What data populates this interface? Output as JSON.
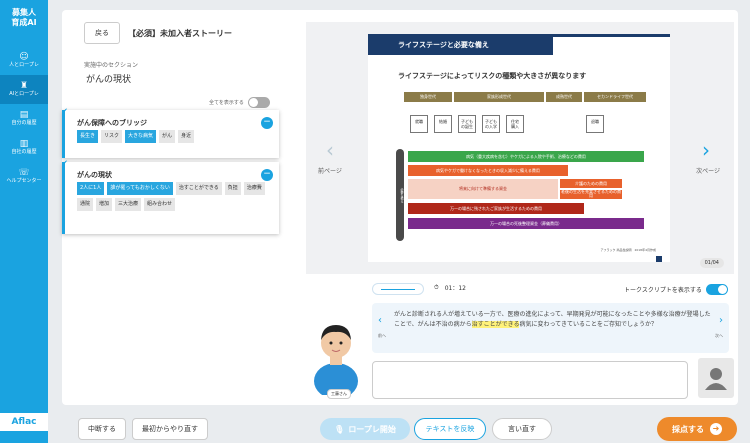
{
  "sidebar": {
    "brand_line1": "募集人",
    "brand_line2": "育成AI",
    "items": [
      {
        "label": "人とロープレ",
        "icon": "smile-icon",
        "glyph": "☺"
      },
      {
        "label": "AIとロープレ",
        "icon": "robot-icon",
        "glyph": "♜"
      },
      {
        "label": "自分の履歴",
        "icon": "history-icon",
        "glyph": "▤"
      },
      {
        "label": "自社の履歴",
        "icon": "bar-chart-icon",
        "glyph": "▥"
      },
      {
        "label": "ヘルプセンター",
        "icon": "headset-icon",
        "glyph": "☏"
      }
    ],
    "logo": "Aflac"
  },
  "header": {
    "back_label": "戻る",
    "title": "【必須】未加入者ストーリー"
  },
  "section": {
    "label": "実施中のセクション",
    "value": "がんの現状",
    "show_all_label": "全てを表示する"
  },
  "keywords": [
    {
      "title": "がん保障へのブリッジ",
      "tags": [
        {
          "text": "長生き",
          "hl": true
        },
        {
          "text": "リスク",
          "hl": false
        },
        {
          "text": "大きな病気",
          "hl": true
        },
        {
          "text": "がん",
          "hl": false
        },
        {
          "text": "身近",
          "hl": false
        }
      ]
    },
    {
      "title": "がんの現状",
      "tags": [
        {
          "text": "2人に1人",
          "hl": true
        },
        {
          "text": "誰が罹ってもおかしくない",
          "hl": true
        },
        {
          "text": "治すことができる",
          "hl": false
        },
        {
          "text": "負担",
          "hl": false
        },
        {
          "text": "治療費",
          "hl": false
        },
        {
          "text": "通院",
          "hl": false
        },
        {
          "text": "増加",
          "hl": false
        },
        {
          "text": "三大治療",
          "hl": false
        },
        {
          "text": "組み合わせ",
          "hl": false
        }
      ]
    }
  ],
  "viewer": {
    "prev_label": "前ページ",
    "next_label": "次ページ",
    "page": "01/04"
  },
  "slide": {
    "heading": "ライフステージと必要な備え",
    "subheading": "ライフステージによってリスクの種類や大きさが異なります",
    "stages": [
      "独身世代",
      "家族形成世代",
      "成熟世代",
      "セカンドライフ世代"
    ],
    "events": [
      {
        "line1": "就職",
        "line2": ""
      },
      {
        "line1": "結婚",
        "line2": ""
      },
      {
        "line1": "子ども",
        "line2": "の誕生"
      },
      {
        "line1": "子ども",
        "line2": "の入学"
      },
      {
        "line1": "住宅",
        "line2": "購入"
      },
      {
        "line1": "退職",
        "line2": ""
      }
    ],
    "bars": [
      {
        "text": "病気（重大疾病を含む）やケガによる入院や手術、治療などの費用",
        "color": "#3aa64b"
      },
      {
        "text": "病気やケガで働けなくなったときの収入減少に備える費用",
        "color": "#e8612c"
      },
      {
        "text": "将来に向けて準備する資金",
        "color": "#f6d2c4"
      },
      {
        "text": "介護のための費用",
        "color": "#e8612c"
      },
      {
        "text": "老後の生活を充実させるための費用",
        "color": "#e8612c"
      },
      {
        "text": "万一の場合に残されたご家族が生活するための費用",
        "color": "#b0281a"
      },
      {
        "text": "万一の場合の死後整理資金（葬儀費用）",
        "color": "#7a2a8c"
      }
    ],
    "vertical_label": "必要な備え",
    "credit": "アフラック 商品性説明　2018年4月作成"
  },
  "player": {
    "time": "01：12",
    "transcript_label": "トークスクリプトを表示する"
  },
  "script": {
    "before": "がんと診断される人が増えている一方で、医療の進化によって、早期発見が可能になったことや多様な治療が登場したことで、がんは不治の病から",
    "highlight": "治すことができる",
    "after": "病気に変わってきていることをご存知でしょうか？",
    "prev_label": "前へ",
    "next_label": "次へ"
  },
  "persona": {
    "name": "工藤さん"
  },
  "bottom": {
    "pause_label": "中断する",
    "restart_label": "最初からやり直す",
    "roleplay_label": "ロープレ開始",
    "reflect_label": "テキストを反映",
    "redo_label": "言い直す",
    "score_label": "採点する"
  }
}
